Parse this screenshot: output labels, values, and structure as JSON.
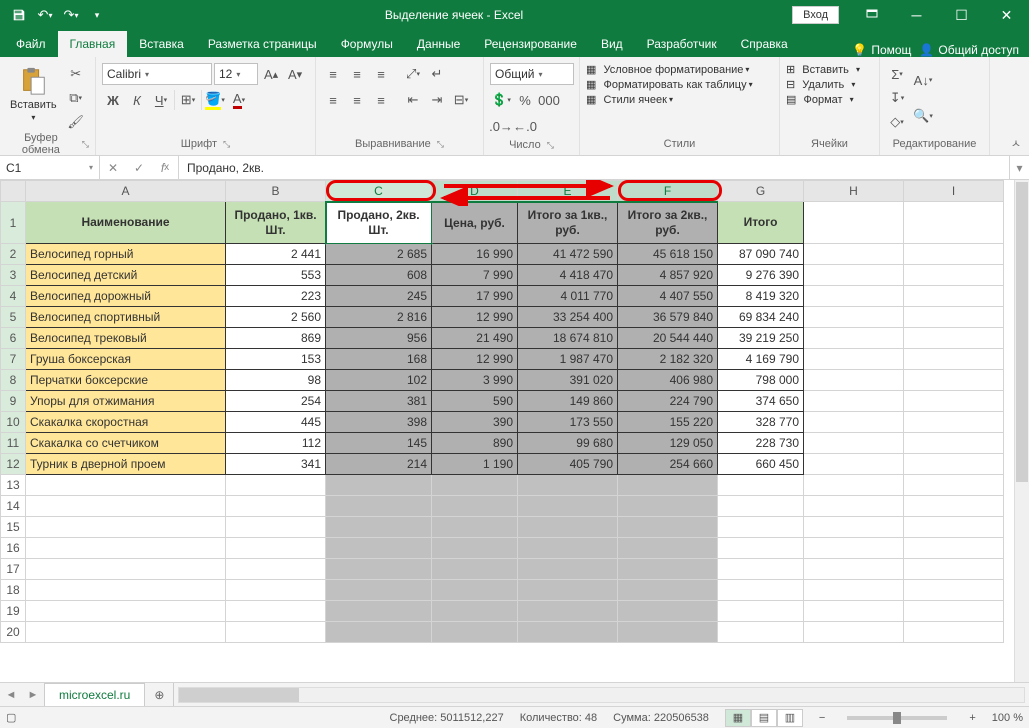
{
  "titlebar": {
    "title": "Выделение ячеек  -  Excel",
    "login": "Вход"
  },
  "tabs": {
    "items": [
      "Файл",
      "Главная",
      "Вставка",
      "Разметка страницы",
      "Формулы",
      "Данные",
      "Рецензирование",
      "Вид",
      "Разработчик",
      "Справка"
    ],
    "active": 1,
    "tell_me": "Помощ",
    "share": "Общий доступ"
  },
  "ribbon": {
    "clipboard": {
      "paste": "Вставить",
      "label": "Буфер обмена"
    },
    "font": {
      "name": "Calibri",
      "size": "12",
      "label": "Шрифт"
    },
    "align": {
      "label": "Выравнивание"
    },
    "number": {
      "format": "Общий",
      "label": "Число"
    },
    "styles": {
      "cond": "Условное форматирование",
      "table": "Форматировать как таблицу",
      "cell": "Стили ячеек",
      "label": "Стили"
    },
    "cells": {
      "insert": "Вставить",
      "delete": "Удалить",
      "format": "Формат",
      "label": "Ячейки"
    },
    "editing": {
      "label": "Редактирование"
    }
  },
  "formula": {
    "namebox": "C1",
    "content": "Продано, 2кв."
  },
  "columns": [
    "A",
    "B",
    "C",
    "D",
    "E",
    "F",
    "G",
    "H",
    "I"
  ],
  "headers": [
    "Наименование",
    "Продано, 1кв. Шт.",
    "Продано, 2кв. Шт.",
    "Цена, руб.",
    "Итого за 1кв., руб.",
    "Итого за 2кв., руб.",
    "Итого"
  ],
  "rows": [
    {
      "n": "Велосипед горный",
      "b": "2 441",
      "c": "2 685",
      "d": "16 990",
      "e": "41 472 590",
      "f": "45 618 150",
      "g": "87 090 740"
    },
    {
      "n": "Велосипед детский",
      "b": "553",
      "c": "608",
      "d": "7 990",
      "e": "4 418 470",
      "f": "4 857 920",
      "g": "9 276 390"
    },
    {
      "n": "Велосипед дорожный",
      "b": "223",
      "c": "245",
      "d": "17 990",
      "e": "4 011 770",
      "f": "4 407 550",
      "g": "8 419 320"
    },
    {
      "n": "Велосипед спортивный",
      "b": "2 560",
      "c": "2 816",
      "d": "12 990",
      "e": "33 254 400",
      "f": "36 579 840",
      "g": "69 834 240"
    },
    {
      "n": "Велосипед трековый",
      "b": "869",
      "c": "956",
      "d": "21 490",
      "e": "18 674 810",
      "f": "20 544 440",
      "g": "39 219 250"
    },
    {
      "n": "Груша боксерская",
      "b": "153",
      "c": "168",
      "d": "12 990",
      "e": "1 987 470",
      "f": "2 182 320",
      "g": "4 169 790"
    },
    {
      "n": "Перчатки боксерские",
      "b": "98",
      "c": "102",
      "d": "3 990",
      "e": "391 020",
      "f": "406 980",
      "g": "798 000"
    },
    {
      "n": "Упоры для отжимания",
      "b": "254",
      "c": "381",
      "d": "590",
      "e": "149 860",
      "f": "224 790",
      "g": "374 650"
    },
    {
      "n": "Скакалка скоростная",
      "b": "445",
      "c": "398",
      "d": "390",
      "e": "173 550",
      "f": "155 220",
      "g": "328 770"
    },
    {
      "n": "Скакалка со счетчиком",
      "b": "112",
      "c": "145",
      "d": "890",
      "e": "99 680",
      "f": "129 050",
      "g": "228 730"
    },
    {
      "n": "Турник в дверной проем",
      "b": "341",
      "c": "214",
      "d": "1 190",
      "e": "405 790",
      "f": "254 660",
      "g": "660 450"
    }
  ],
  "sheet": {
    "name": "microexcel.ru"
  },
  "status": {
    "avg_l": "Среднее:",
    "avg": "5011512,227",
    "cnt_l": "Количество:",
    "cnt": "48",
    "sum_l": "Сумма:",
    "sum": "220506538",
    "zoom": "100 %"
  }
}
